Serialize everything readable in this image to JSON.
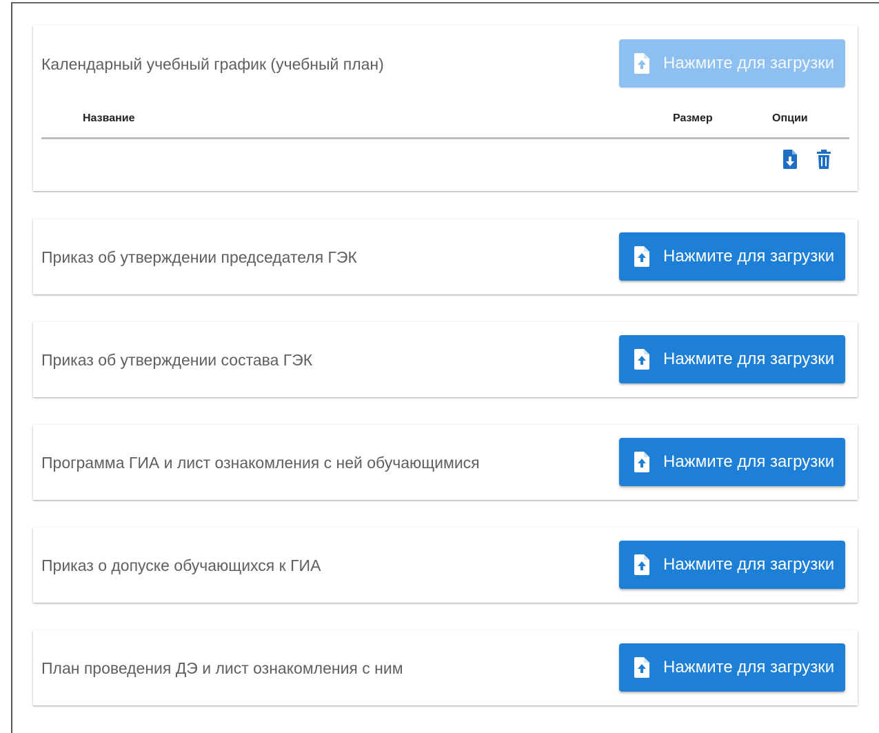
{
  "upload_label": "Нажмите для загрузки",
  "colors": {
    "primary": "#1e7fd6",
    "primary_disabled": "#8dbff0",
    "text": "#5f5f5f"
  },
  "table_headers": {
    "name": "Название",
    "size": "Размер",
    "options": "Опции"
  },
  "row_actions": [
    "download-file-icon",
    "trash-icon"
  ],
  "documents": [
    {
      "title": "Календарный учебный график (учебный план)",
      "upload_enabled": false
    },
    {
      "title": "Приказ об утверждении председателя ГЭК",
      "upload_enabled": true
    },
    {
      "title": "Приказ об утверждении состава ГЭК",
      "upload_enabled": true
    },
    {
      "title": "Программа ГИА и лист ознакомления с ней обучающимися",
      "upload_enabled": true
    },
    {
      "title": "Приказ о допуске обучающихся к ГИА",
      "upload_enabled": true
    },
    {
      "title": "План проведения ДЭ и лист ознакомления с ним",
      "upload_enabled": true
    }
  ]
}
